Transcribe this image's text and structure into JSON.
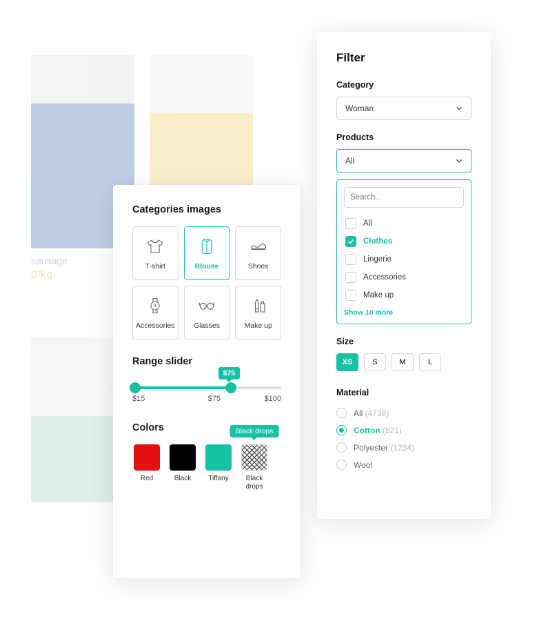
{
  "background": {
    "item_label": "sausage",
    "item_price": "0/kg"
  },
  "categories_panel": {
    "title": "Categories images",
    "tiles": [
      {
        "label": "T-shirt"
      },
      {
        "label": "Blouse"
      },
      {
        "label": "Shoes"
      },
      {
        "label": "Accessories"
      },
      {
        "label": "Glasses"
      },
      {
        "label": "Make up"
      }
    ]
  },
  "range": {
    "title": "Range slider",
    "tooltip": "$75",
    "min_label": "$15",
    "cur_label": "$75",
    "max_label": "$100"
  },
  "colors": {
    "title": "Colors",
    "tip": "Black drops",
    "items": [
      {
        "label": "Red",
        "value": "#e41111"
      },
      {
        "label": "Black",
        "value": "#000000"
      },
      {
        "label": "Tiffany",
        "value": "#17c1a3"
      },
      {
        "label": "Black drops",
        "value": "pattern"
      }
    ]
  },
  "filter": {
    "heading": "Filter",
    "category_label": "Category",
    "category_value": "Woman",
    "products_label": "Products",
    "products_value": "All",
    "search_placeholder": "Search...",
    "product_options": [
      {
        "label": "All",
        "selected": false
      },
      {
        "label": "Clothes",
        "selected": true
      },
      {
        "label": "Lingerie",
        "selected": false
      },
      {
        "label": "Accessories",
        "selected": false
      },
      {
        "label": "Make up",
        "selected": false
      }
    ],
    "show_more": "Show 10 more",
    "size_label": "Size",
    "sizes": [
      "XS",
      "S",
      "M",
      "L"
    ],
    "size_selected": "XS",
    "material_label": "Material",
    "materials": [
      {
        "label": "All",
        "count": "(4738)",
        "selected": false
      },
      {
        "label": "Cotton",
        "count": "(821)",
        "selected": true
      },
      {
        "label": "Polyester",
        "count": "(1234)",
        "selected": false
      },
      {
        "label": "Wool",
        "count": "",
        "selected": false
      }
    ]
  }
}
